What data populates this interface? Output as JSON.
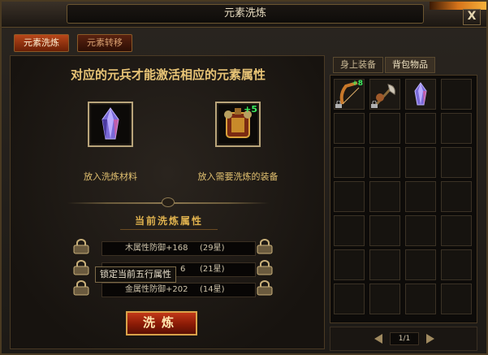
{
  "window": {
    "title": "元素洗炼",
    "close_label": "X"
  },
  "tabs": [
    {
      "label": "元素洗炼",
      "active": true
    },
    {
      "label": "元素转移",
      "active": false
    }
  ],
  "main": {
    "headline": "对应的元兵才能激活相应的元素属性",
    "material_slot": {
      "caption": "放入洗炼材料",
      "icon": "blue-crystal-icon"
    },
    "equipment_slot": {
      "caption": "放入需要洗炼的装备",
      "icon": "armor-icon",
      "enhance": "+5"
    },
    "section_title": "当前洗炼属性",
    "attributes": [
      {
        "text": "木属性防御+168",
        "stars": "(29星)"
      },
      {
        "text": "6",
        "stars": "(21星)"
      },
      {
        "text": "金属性防御+202",
        "stars": "(14星)"
      }
    ],
    "tooltip": "锁定当前五行属性",
    "refine_button": "洗炼"
  },
  "bag": {
    "tabs": [
      {
        "label": "身上装备",
        "active": false
      },
      {
        "label": "背包物品",
        "active": true
      }
    ],
    "items": [
      {
        "icon": "bow-icon",
        "enhance": "+8",
        "locked": true
      },
      {
        "icon": "axe-icon",
        "enhance": "",
        "locked": true
      },
      {
        "icon": "blue-crystal-icon",
        "enhance": "",
        "locked": false
      }
    ],
    "pagination": "1/1"
  },
  "colors": {
    "accent_gold": "#e8c476",
    "active_tab": "#b8471a",
    "enhance_green": "#3cf060"
  }
}
